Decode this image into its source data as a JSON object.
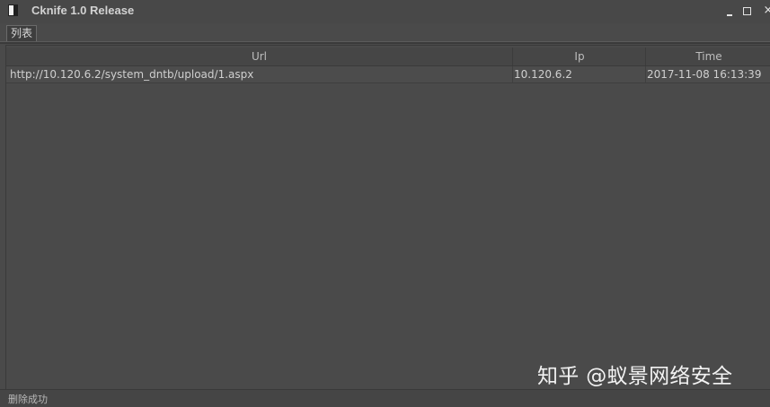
{
  "window": {
    "title": "Cknife 1.0 Release",
    "controls": {
      "close": "×"
    }
  },
  "tabs": [
    {
      "label": "列表"
    }
  ],
  "table": {
    "columns": [
      "Url",
      "Ip",
      "Time"
    ],
    "rows": [
      {
        "url": "http://10.120.6.2/system_dntb/upload/1.aspx",
        "ip": "10.120.6.2",
        "time": "2017-11-08 16:13:39"
      }
    ]
  },
  "status": {
    "text": "删除成功"
  },
  "watermark": {
    "text": "知乎 @蚁景网络安全"
  },
  "colors": {
    "background": "#4a4a4a",
    "text": "#cfcfcf",
    "header_text": "#bdbdbd"
  }
}
